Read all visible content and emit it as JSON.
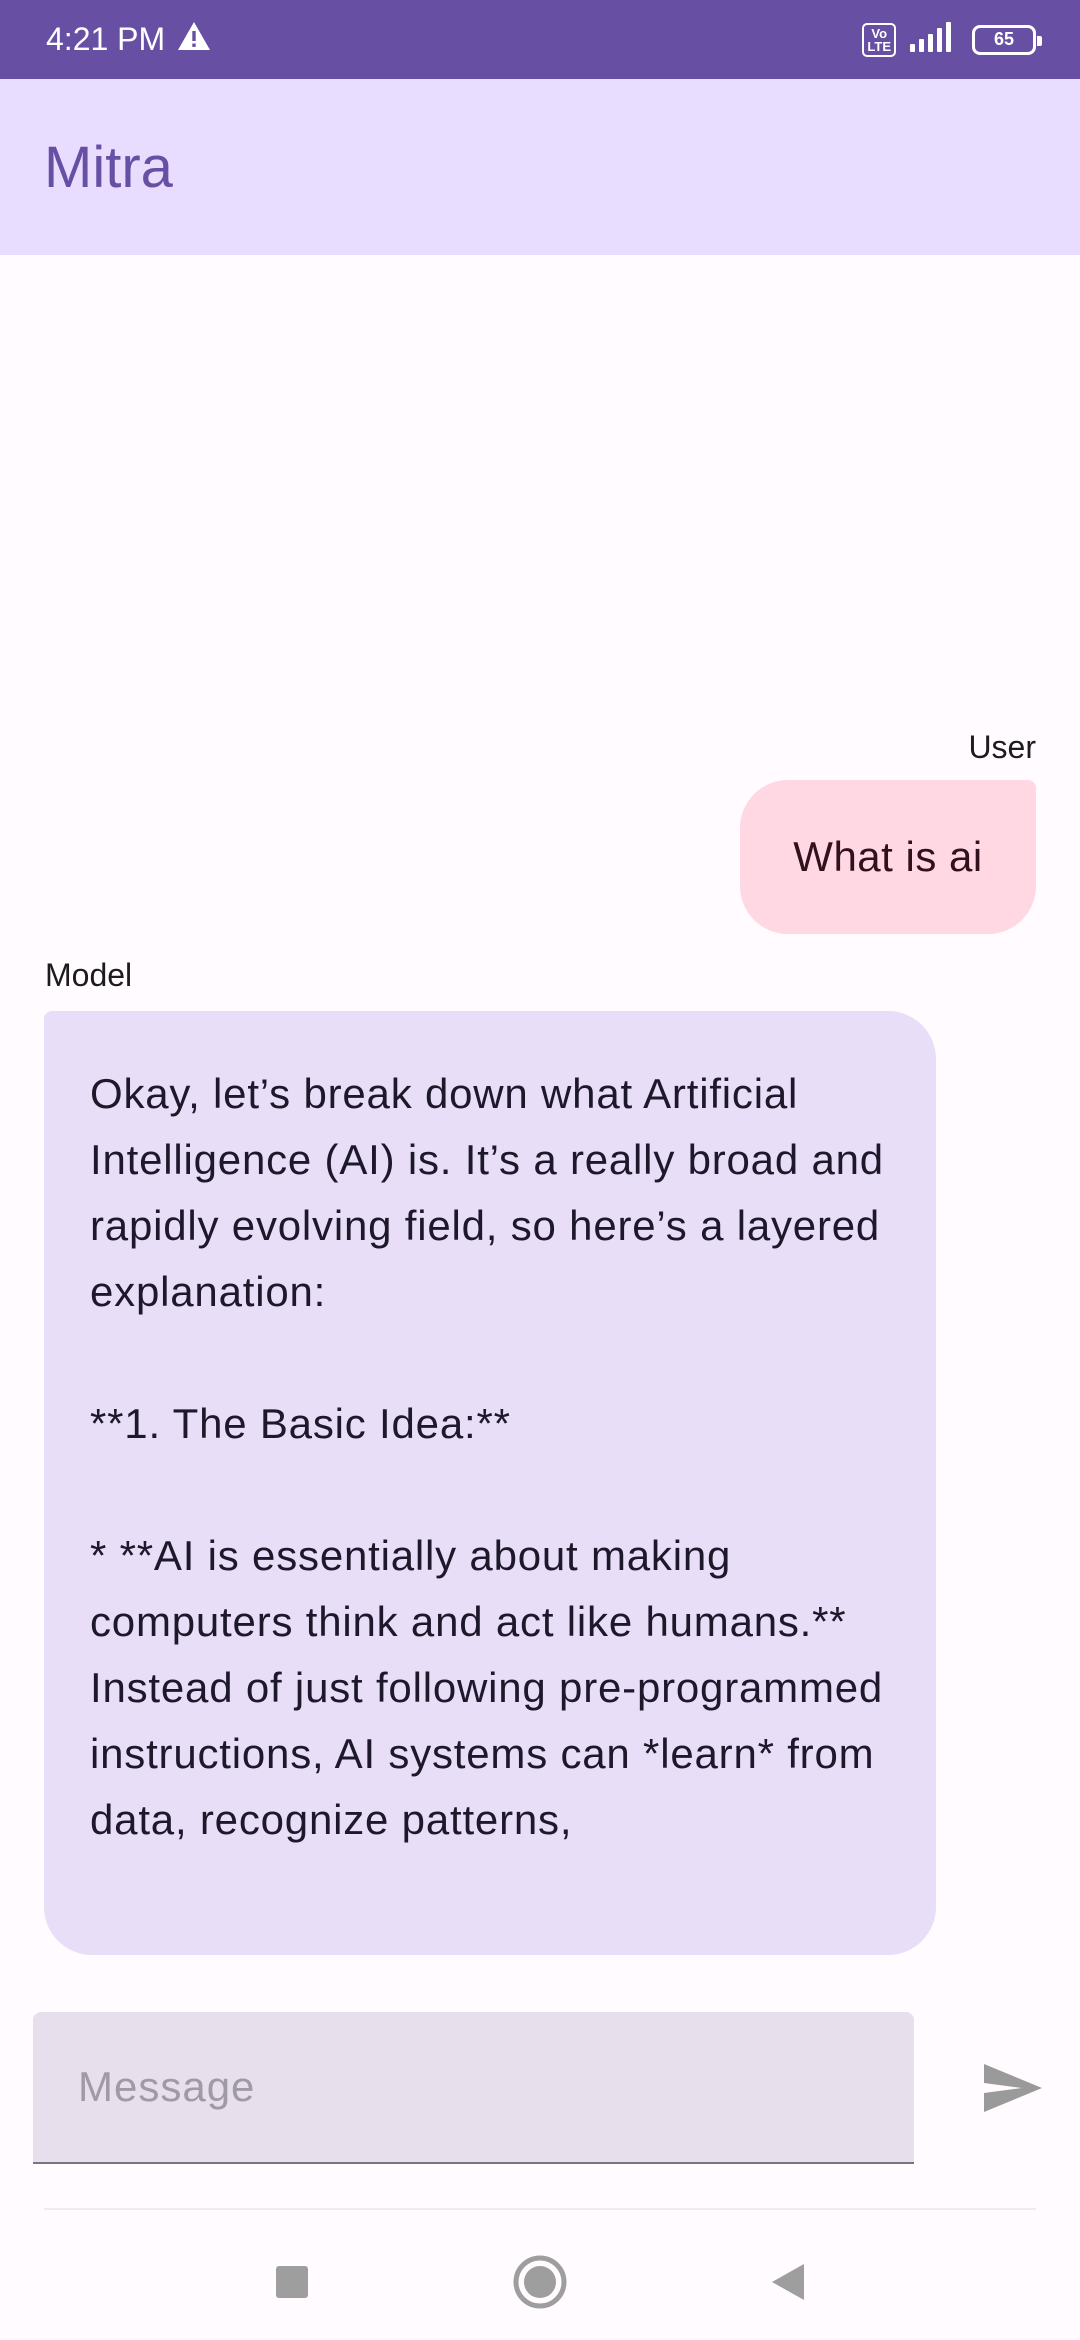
{
  "status_bar": {
    "time": "4:21 PM",
    "volte_top": "Vo",
    "volte_bottom": "LTE",
    "battery": "65"
  },
  "app_bar": {
    "title": "Mitra"
  },
  "messages": [
    {
      "sender": "User",
      "text": "What is ai"
    },
    {
      "sender": "Model",
      "text": "Okay, let’s break down what Artificial Intelligence (AI) is. It’s a really broad and rapidly evolving field, so here’s a layered explanation:\n\n**1. The Basic Idea:**\n\n* **AI is essentially about making computers think and act like humans.** Instead of just following pre-programmed instructions, AI systems can *learn* from data, recognize patterns,"
    }
  ],
  "composer": {
    "placeholder": "Message",
    "value": ""
  },
  "icons": {
    "warning": "warning-icon",
    "signal": "signal-icon",
    "battery": "battery-icon",
    "send": "send-icon",
    "recent": "recent-apps-icon",
    "home": "home-icon",
    "back": "back-icon"
  },
  "colors": {
    "primary": "#6750a4",
    "app_bar_bg": "#e9ddff",
    "user_bubble": "#ffd8e4",
    "model_bubble": "#e8def8",
    "input_bg": "#e7e0ec"
  }
}
